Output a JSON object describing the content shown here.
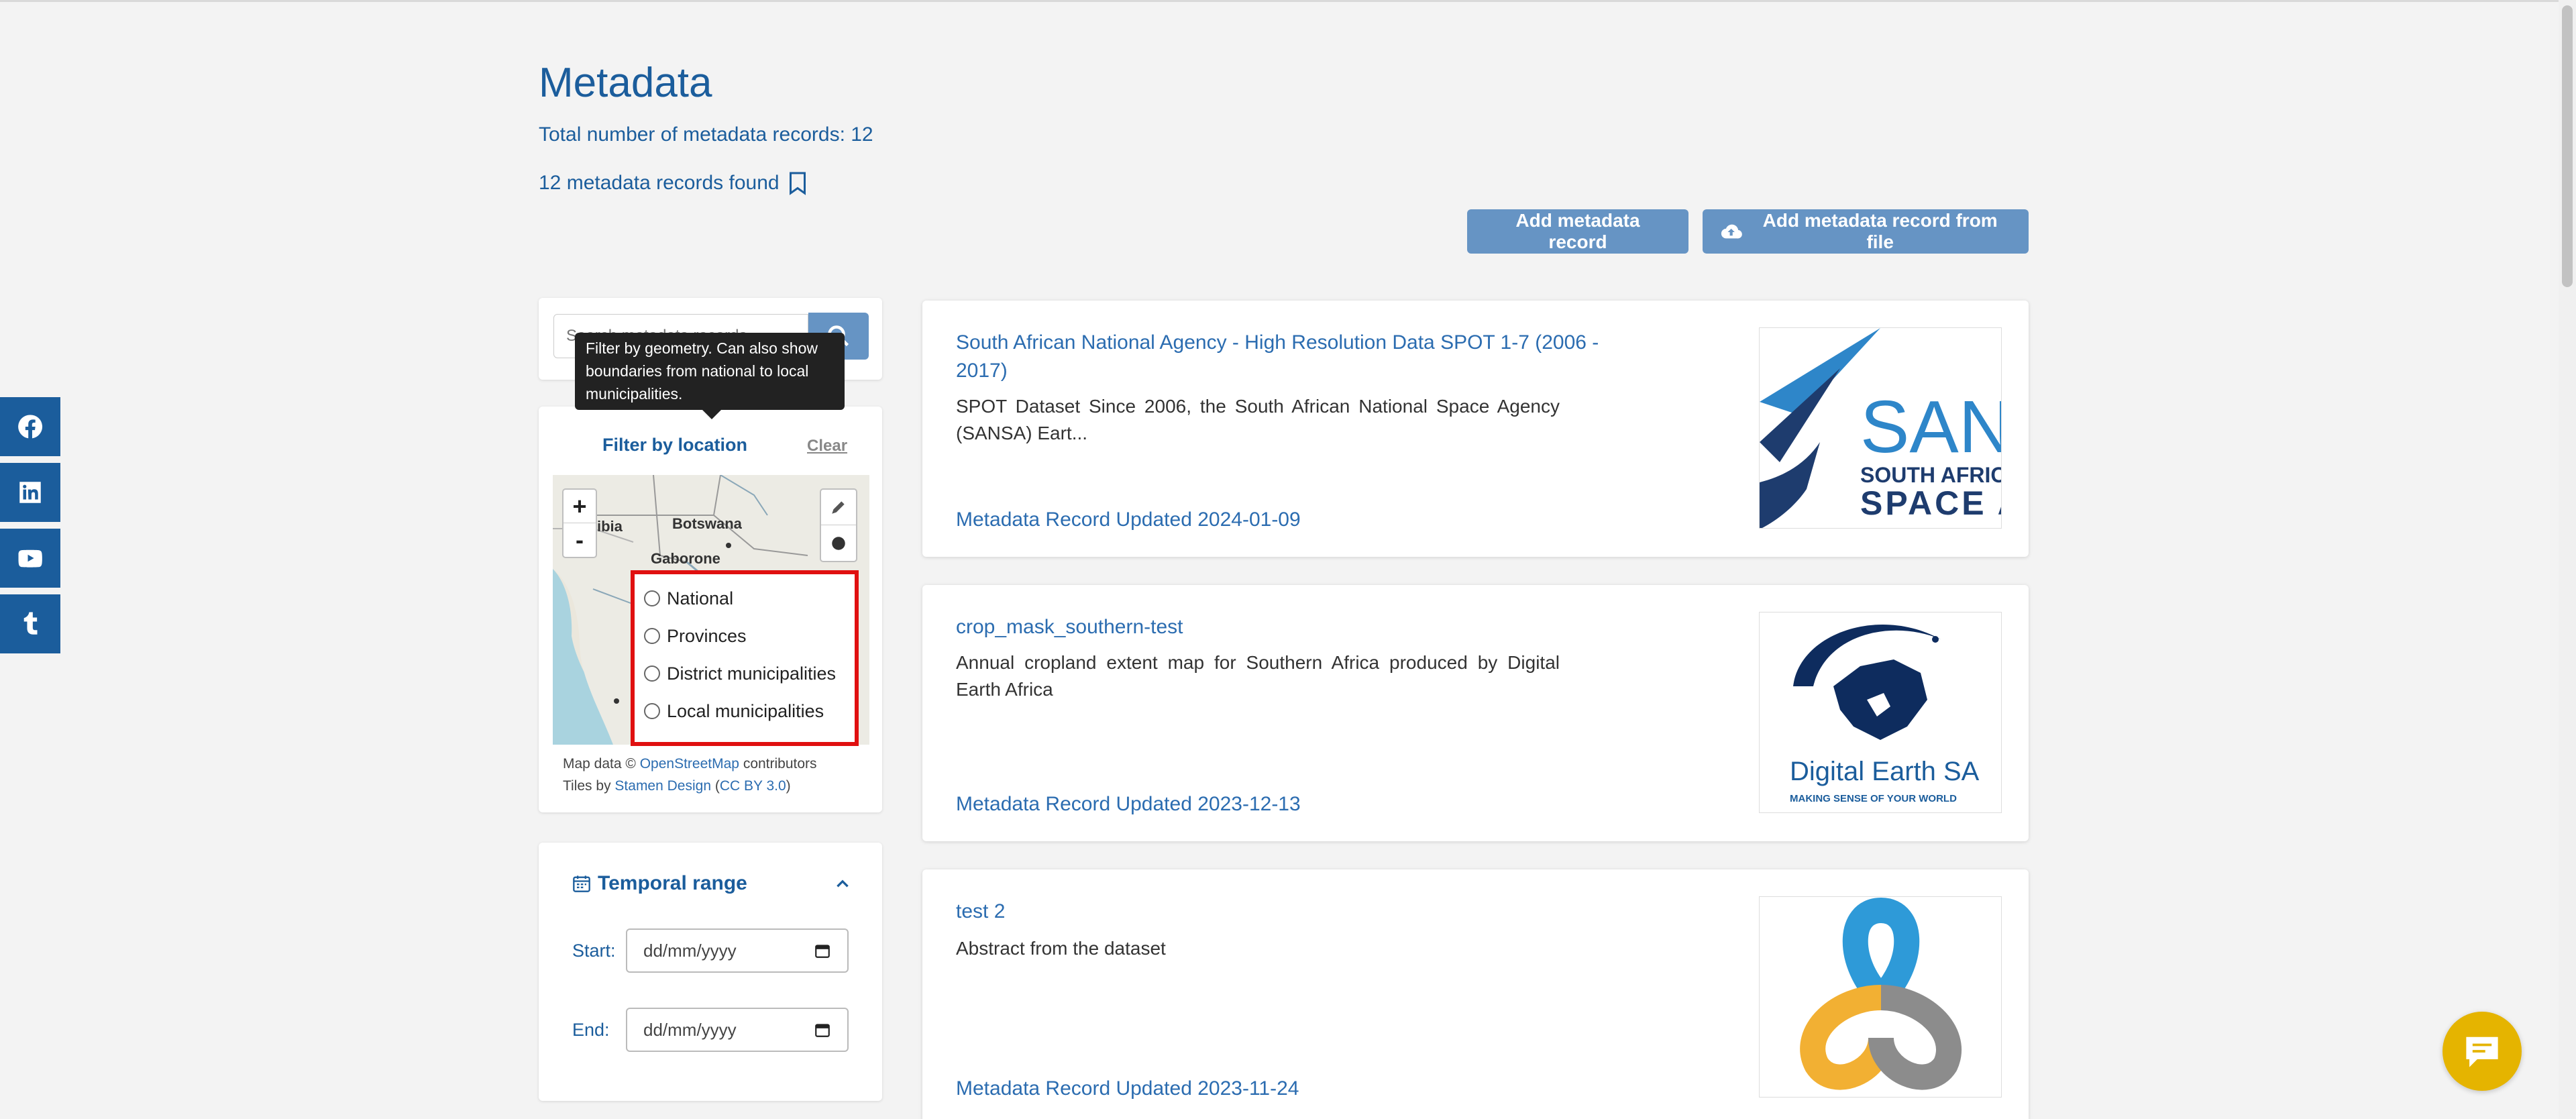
{
  "header": {
    "title": "Metadata",
    "total_label": "Total number of metadata records: 12",
    "found_label": "12 metadata records found"
  },
  "actions": {
    "add_record": "Add metadata record",
    "add_from_file": "Add metadata record from file"
  },
  "search": {
    "placeholder": "Search metadata records"
  },
  "tooltip": {
    "text": "Filter by geometry. Can also show boundaries from national to local municipalities."
  },
  "location_filter": {
    "title": "Filter by location",
    "clear_label": "Clear",
    "map_labels": [
      "ibia",
      "Botswana",
      "Gaborone"
    ],
    "zoom_in": "+",
    "zoom_out": "-",
    "boundary_options": [
      "National",
      "Provinces",
      "District municipalities",
      "Local municipalities"
    ],
    "attribution": {
      "map_data_prefix": "Map data ©",
      "osm_link": "OpenStreetMap",
      "contributors": "contributors",
      "tiles_prefix": "Tiles by",
      "stamen_link": "Stamen Design",
      "license_link": "CC BY 3.0"
    }
  },
  "temporal": {
    "title": "Temporal range",
    "start_label": "Start:",
    "end_label": "End:",
    "start_value": "dd/mm/yyyy",
    "end_value": "dd/mm/yyyy"
  },
  "records": [
    {
      "title": "South African National Agency - High Resolution Data SPOT 1-7 (2006 - 2017)",
      "abstract": "SPOT Dataset Since 2006, the South African National Space Agency (SANSA) Eart...",
      "updated": "Metadata Record Updated 2024-01-09",
      "logo_text": [
        "SAN",
        "SOUTH AFRICA",
        "SPACE A"
      ]
    },
    {
      "title": "crop_mask_southern-test",
      "abstract": "Annual cropland extent map for Southern Africa produced by Digital Earth Africa",
      "updated": "Metadata Record Updated 2023-12-13",
      "logo_text": [
        "Digital Earth SA",
        "MAKING SENSE OF YOUR WORLD"
      ]
    },
    {
      "title": "test 2",
      "abstract": "Abstract from the dataset",
      "updated": "Metadata Record Updated 2023-11-24",
      "logo_text": []
    }
  ],
  "colors": {
    "brand_blue": "#1b5d9c",
    "button_blue": "#6694c4",
    "link_blue": "#2b6cb0",
    "highlight_red": "#e01010",
    "chat_yellow": "#e5b400"
  },
  "icons": {
    "social": [
      "facebook-icon",
      "linkedin-icon",
      "youtube-icon",
      "tumblr-icon"
    ],
    "bookmark": "bookmark-icon",
    "upload": "cloud-upload-icon",
    "search": "search-icon",
    "calendar": "calendar-icon",
    "chat": "chat-icon"
  }
}
